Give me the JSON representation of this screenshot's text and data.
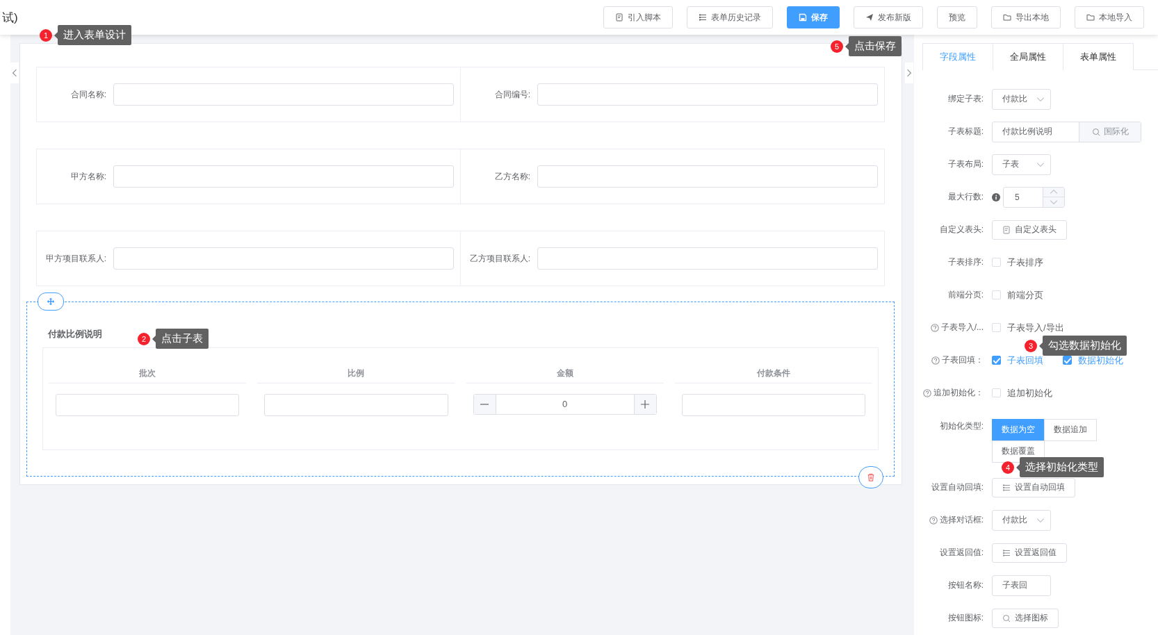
{
  "header": {
    "title": "试)",
    "toolbar": [
      {
        "label": "引入脚本",
        "primary": false
      },
      {
        "label": "表单历史记录",
        "primary": false
      },
      {
        "label": "保存",
        "primary": true
      },
      {
        "label": "发布新版",
        "primary": false
      },
      {
        "label": "预览",
        "primary": false
      },
      {
        "label": "导出本地",
        "primary": false
      },
      {
        "label": "本地导入",
        "primary": false
      }
    ]
  },
  "form_rows": [
    {
      "fields": [
        {
          "label": "合同名称:"
        },
        {
          "label": "合同编号:"
        }
      ]
    },
    {
      "fields": [
        {
          "label": "甲方名称:"
        },
        {
          "label": "乙方名称:"
        }
      ]
    },
    {
      "fields": [
        {
          "label": "甲方项目联系人:"
        },
        {
          "label": "乙方项目联系人:"
        }
      ]
    }
  ],
  "subform": {
    "title": "付款比例说明",
    "columns": [
      {
        "header": "批次",
        "kind": "input"
      },
      {
        "header": "比例",
        "kind": "input"
      },
      {
        "header": "金额",
        "kind": "number",
        "value": "0"
      },
      {
        "header": "付款条件",
        "kind": "input"
      }
    ]
  },
  "panel": {
    "tabs": [
      {
        "label": "字段属性",
        "selected": true
      },
      {
        "label": "全局属性",
        "selected": false
      },
      {
        "label": "表单属性",
        "selected": false
      }
    ],
    "properties": [
      {
        "kind": "select",
        "label": "绑定子表:",
        "value": "付款比"
      },
      {
        "kind": "input_addon",
        "label": "子表标题:",
        "value": "付款比例说明",
        "addon": "国际化"
      },
      {
        "kind": "select",
        "label": "子表布局:",
        "value": "子表"
      },
      {
        "kind": "number",
        "label": "最大行数:",
        "value": "5"
      },
      {
        "kind": "button",
        "label": "自定义表头:",
        "button": "自定义表头"
      },
      {
        "kind": "checkbox",
        "label": "子表排序:",
        "options": [
          {
            "label": "子表排序",
            "checked": false
          }
        ]
      },
      {
        "kind": "checkbox",
        "label": "前端分页:",
        "options": [
          {
            "label": "前端分页",
            "checked": false
          }
        ]
      },
      {
        "kind": "checkbox",
        "label": "子表导入/...",
        "options": [
          {
            "label": "子表导入/导出",
            "checked": false
          }
        ]
      },
      {
        "kind": "checkbox",
        "label": "子表回填：",
        "options": [
          {
            "label": "子表回填",
            "checked": true
          },
          {
            "label": "数据初始化",
            "checked": true
          }
        ]
      },
      {
        "kind": "checkbox",
        "label": "追加初始化：",
        "options": [
          {
            "label": "追加初始化",
            "checked": false
          }
        ]
      },
      {
        "kind": "radio",
        "label": "初始化类型:",
        "options": [
          {
            "label": "数据为空",
            "selected": true
          },
          {
            "label": "数据追加",
            "selected": false
          },
          {
            "label": "数据覆盖",
            "selected": false
          }
        ]
      },
      {
        "kind": "button",
        "label": "设置自动回填:",
        "button": "设置自动回填"
      },
      {
        "kind": "select",
        "label": "选择对话框:",
        "value": "付款比"
      },
      {
        "kind": "button",
        "label": "设置返回值:",
        "button": "设置返回值"
      },
      {
        "kind": "input",
        "label": "按钮名称:",
        "value": "子表回"
      },
      {
        "kind": "button",
        "label": "按钮图标:",
        "button": "选择图标"
      }
    ]
  },
  "annotations": [
    {
      "number": "1",
      "text": "进入表单设计"
    },
    {
      "number": "5",
      "text": "点击保存"
    },
    {
      "number": "2",
      "text": "点击子表"
    },
    {
      "number": "3",
      "text": "勾选数据初始化"
    },
    {
      "number": "4",
      "text": "选择初始化类型"
    }
  ]
}
